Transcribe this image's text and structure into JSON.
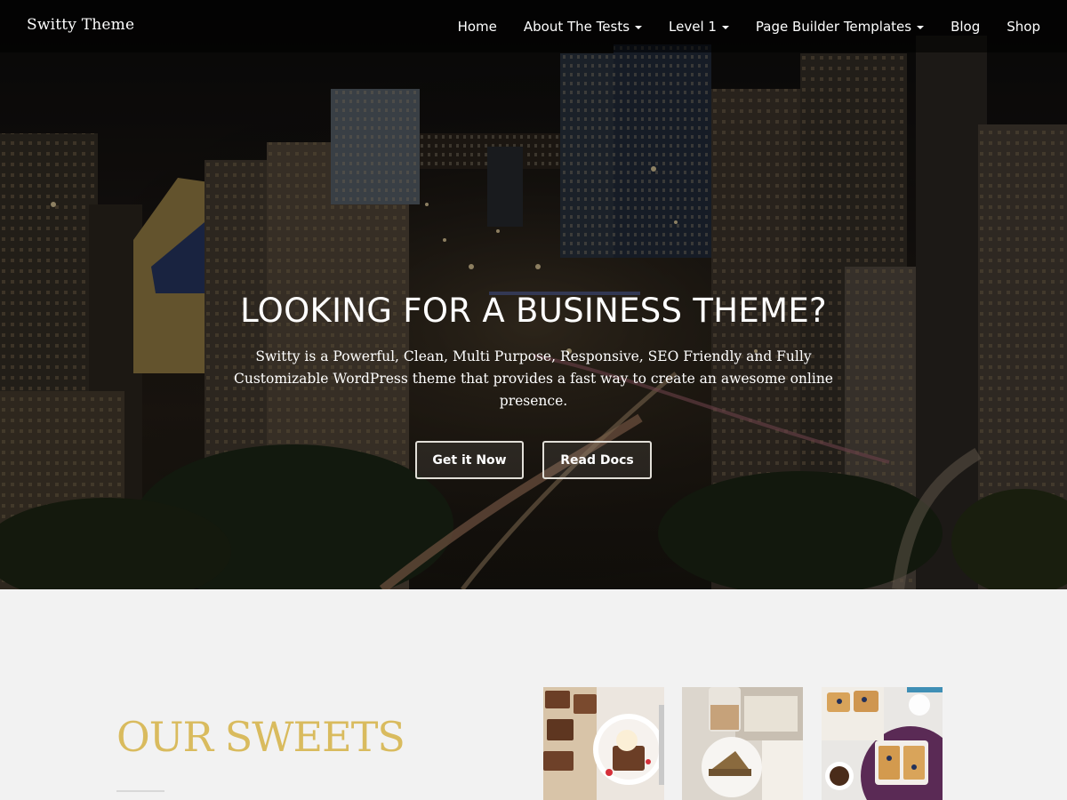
{
  "header": {
    "site_title": "Switty Theme",
    "nav": [
      {
        "label": "Home",
        "has_dropdown": false
      },
      {
        "label": "About The Tests",
        "has_dropdown": true
      },
      {
        "label": "Level 1",
        "has_dropdown": true
      },
      {
        "label": "Page Builder Templates",
        "has_dropdown": true
      },
      {
        "label": "Blog",
        "has_dropdown": false
      },
      {
        "label": "Shop",
        "has_dropdown": false
      }
    ]
  },
  "hero": {
    "background_image": "night-city-skyline-photo",
    "title": "LOOKING FOR A BUSINESS THEME?",
    "description": "Switty is a Powerful, Clean, Multi Purpose, Responsive, SEO Friendly and Fully Customizable WordPress theme that provides a fast way to create an awesome online presence.",
    "buttons": {
      "primary": "Get it Now",
      "secondary": "Read Docs"
    }
  },
  "sweets": {
    "title": "OUR SWEETS",
    "images": [
      {
        "icon": "brownies-and-ice-cream-photo"
      },
      {
        "icon": "cake-and-latte-photo"
      },
      {
        "icon": "waffles-and-coffee-photo"
      }
    ]
  },
  "colors": {
    "accent_gold": "#d9bb5e",
    "header_overlay": "rgba(0,0,0,0.55)",
    "section_background": "#f2f2f2",
    "button_border": "#e2dfd8"
  }
}
